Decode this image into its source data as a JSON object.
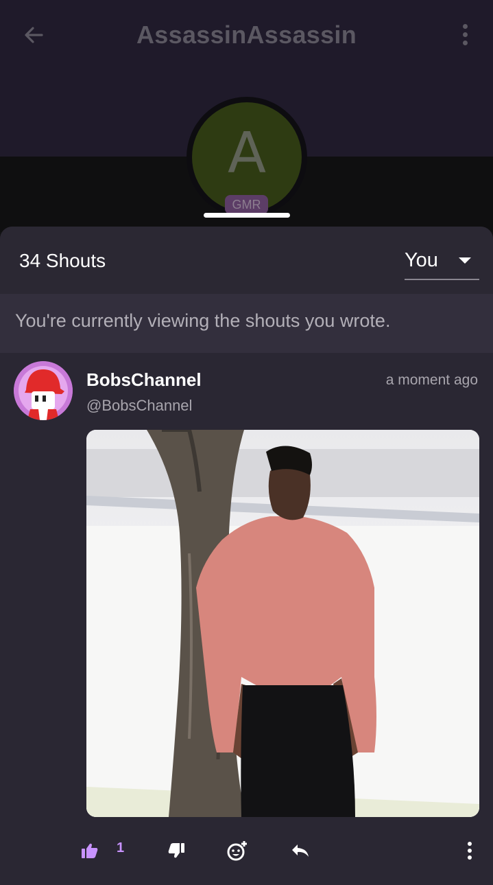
{
  "header": {
    "title": "AssassinAssassin",
    "back_icon": "arrow-left-icon",
    "menu_icon": "more-vertical-icon"
  },
  "profile": {
    "avatar_letter": "A",
    "badge": "GMR",
    "avatar_color": "#2e3b12"
  },
  "shouts": {
    "count_label": "34 Shouts",
    "filter_value": "You",
    "notice": "You're currently viewing the shouts you wrote."
  },
  "post": {
    "author": "BobsChannel",
    "handle": "@BobsChannel",
    "time": "a moment ago",
    "likes": "1",
    "icons": [
      "thumbs-up-icon",
      "thumbs-down-icon",
      "add-reaction-icon",
      "reply-icon",
      "more-vertical-icon"
    ]
  },
  "colors": {
    "accent": "#c893ff",
    "header_bg": "#1f1a2a",
    "sheet_bg": "#2a2733"
  }
}
